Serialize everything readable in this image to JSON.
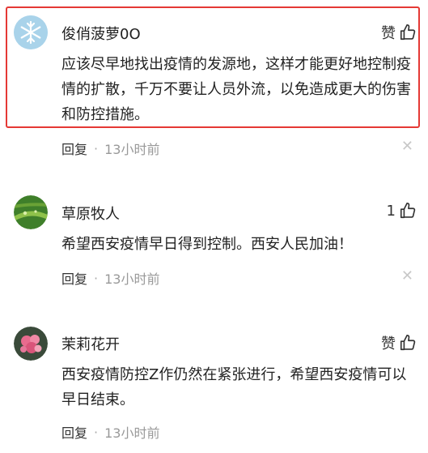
{
  "comments": [
    {
      "username": "俊俏菠萝0O",
      "like_label": "赞",
      "like_count": "",
      "text": "应该尽早地找出疫情的发源地，这样才能更好地控制疫情的扩散，千万不要让人员外流，以免造成更大的伤害和防控措施。",
      "reply_label": "回复",
      "time": "13小时前",
      "avatar_icon": "snowflake-avatar"
    },
    {
      "username": "草原牧人",
      "like_label": "",
      "like_count": "1",
      "text": "希望西安疫情早日得到控制。西安人民加油！",
      "reply_label": "回复",
      "time": "13小时前",
      "avatar_icon": "leaf-avatar"
    },
    {
      "username": "茉莉花开",
      "like_label": "赞",
      "like_count": "",
      "text": "西安疫情防控Z作仍然在紧张进行，希望西安疫情可以早日结束。",
      "reply_label": "回复",
      "time": "13小时前",
      "avatar_icon": "flower-avatar"
    }
  ],
  "separator": "·",
  "close_glyph": "✕",
  "colors": {
    "highlight_border": "#e53935",
    "meta": "#999999",
    "text": "#222222"
  }
}
